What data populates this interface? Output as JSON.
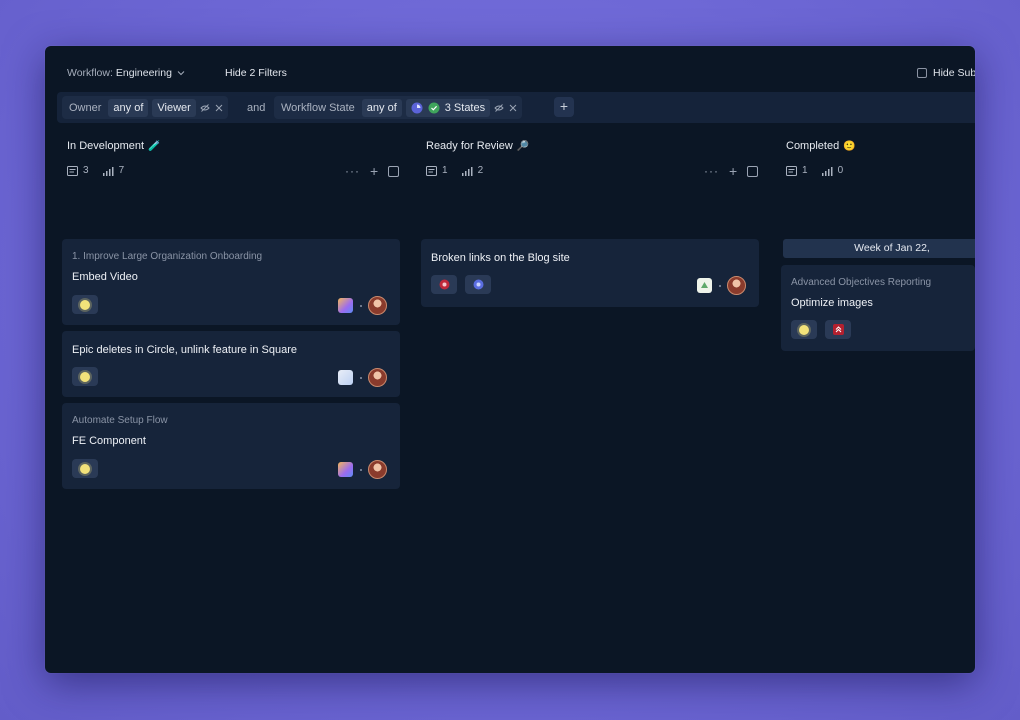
{
  "toolbar": {
    "workflow_label": "Workflow:",
    "workflow_value": "Engineering",
    "hide_filters": "Hide 2 Filters",
    "hide_subissues": "Hide Sub"
  },
  "filters": {
    "owner_label": "Owner",
    "owner_op": "any of",
    "owner_value": "Viewer",
    "connector": "and",
    "state_label": "Workflow State",
    "state_op": "any of",
    "state_value": "3 States",
    "add_label": "+"
  },
  "columns": [
    {
      "title": "In Development",
      "emoji": "🧪",
      "stories": "3",
      "points": "7",
      "cards": [
        {
          "parent": "1. Improve Large Organization Onboarding",
          "title": "Embed Video"
        },
        {
          "parent": "",
          "title": "Epic deletes in Circle, unlink feature in Square"
        },
        {
          "parent": "Automate Setup Flow",
          "title": "FE Component"
        }
      ]
    },
    {
      "title": "Ready for Review",
      "emoji": "🔎",
      "stories": "1",
      "points": "2",
      "cards": [
        {
          "parent": "",
          "title": "Broken links on the Blog site"
        }
      ]
    },
    {
      "title": "Completed",
      "emoji": "🙂",
      "stories": "1",
      "points": "0",
      "week": "Week of Jan 22,",
      "cards": [
        {
          "parent": "Advanced Objectives Reporting",
          "title": "Optimize images"
        }
      ]
    }
  ],
  "colors": {
    "background": "#6f6ad6",
    "window": "#0b1625",
    "card": "#16243a",
    "feature_dot": "#f2e27a",
    "bug_red": "#c0283a"
  }
}
